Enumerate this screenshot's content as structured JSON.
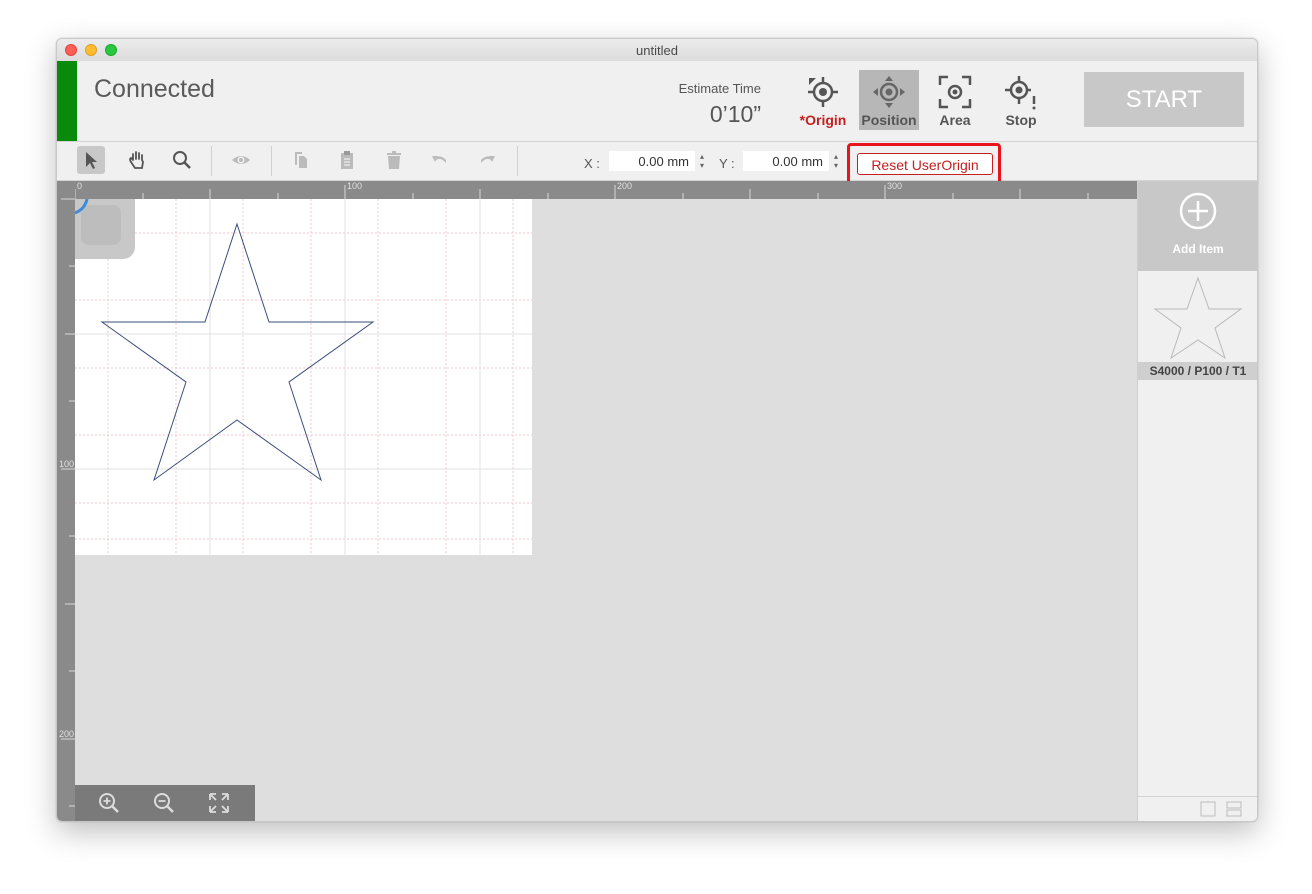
{
  "window": {
    "title": "untitled"
  },
  "header": {
    "status": "Connected",
    "status_color": "#0a8a0a",
    "estimate_label": "Estimate Time",
    "estimate_value": "0’10”",
    "tools": [
      {
        "label": "*Origin",
        "icon": "origin-icon",
        "active": false
      },
      {
        "label": "Position",
        "icon": "position-icon",
        "active": true
      },
      {
        "label": "Area",
        "icon": "area-icon",
        "active": false
      },
      {
        "label": "Stop",
        "icon": "stop-icon",
        "active": false
      }
    ],
    "start_label": "START"
  },
  "toolbar": {
    "x_label": "X :",
    "x_value": "0.00 mm",
    "y_label": "Y :",
    "y_value": "0.00 mm",
    "reset_label": "Reset UserOrigin",
    "accent_color": "#c42020"
  },
  "rulers": {
    "top_labels": [
      "0",
      "100",
      "200",
      "300"
    ],
    "left_labels": [
      "100",
      "200"
    ]
  },
  "side_panel": {
    "add_label": "Add Item",
    "items": [
      {
        "label": "S4000 / P100 / T1"
      }
    ]
  }
}
